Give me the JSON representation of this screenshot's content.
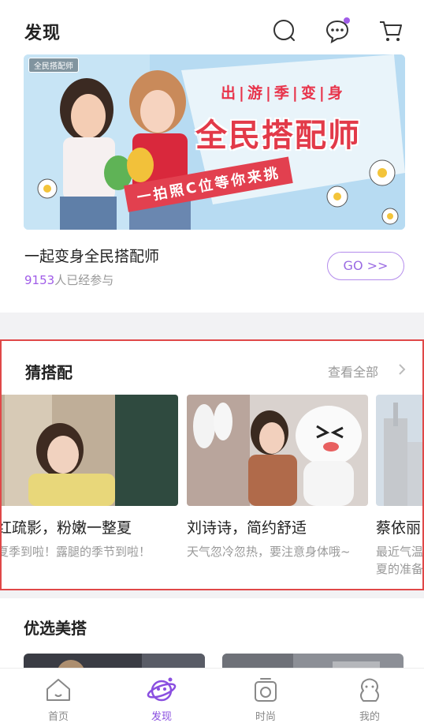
{
  "header": {
    "title": "发现",
    "colors": {
      "accent": "#a05ce8",
      "notify_dot": "#a05ce8"
    }
  },
  "feature": {
    "banner": {
      "tag": "全民搭配师",
      "headline1": "出|游|季|变|身",
      "headline2": "全民搭配师",
      "slogan": "一拍照C位等你来挑"
    },
    "title": "一起变身全民搭配师",
    "count_number": "9153",
    "count_suffix": "人已经参与",
    "go_label": "GO >>"
  },
  "guess": {
    "title": "猜搭配",
    "view_all": "查看全部",
    "cards": [
      {
        "title": "红疏影，粉嫩一整夏",
        "desc": "夏季到啦！露腿的季节到啦！",
        "desc2": ""
      },
      {
        "title": "刘诗诗，简约舒适",
        "desc": "天气忽冷忽热，要注意身体哦~",
        "desc2": ""
      },
      {
        "title": "蔡依丽",
        "desc": "最近气温",
        "desc2": "夏的准备"
      }
    ]
  },
  "selected": {
    "title": "优选美搭"
  },
  "tabbar": {
    "tabs": [
      {
        "label": "首页",
        "icon": "home-icon",
        "active": false
      },
      {
        "label": "发现",
        "icon": "planet-icon",
        "active": true
      },
      {
        "label": "时尚",
        "icon": "camera-icon",
        "active": false
      },
      {
        "label": "我的",
        "icon": "profile-icon",
        "active": false
      }
    ]
  }
}
